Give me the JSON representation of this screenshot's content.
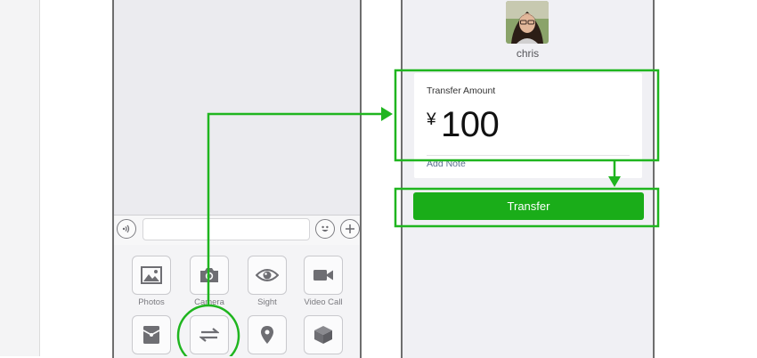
{
  "chat_screen": {
    "panel_items": [
      {
        "label": "Photos",
        "icon": "photo-icon"
      },
      {
        "label": "Camera",
        "icon": "camera-icon"
      },
      {
        "label": "Sight",
        "icon": "eye-icon"
      },
      {
        "label": "Video Call",
        "icon": "video-call-icon"
      },
      {
        "label": "",
        "icon": "red-packet-icon"
      },
      {
        "label": "",
        "icon": "transfer-arrows-icon"
      },
      {
        "label": "",
        "icon": "location-pin-icon"
      },
      {
        "label": "",
        "icon": "cube-icon"
      }
    ]
  },
  "transfer_screen": {
    "recipient_name": "chris",
    "amount_title": "Transfer Amount",
    "currency": "¥",
    "amount": "100",
    "add_note": "Add Note",
    "transfer_button": "Transfer"
  },
  "colors": {
    "annotation_green": "#1fb51f",
    "button_green": "#1aad19"
  }
}
